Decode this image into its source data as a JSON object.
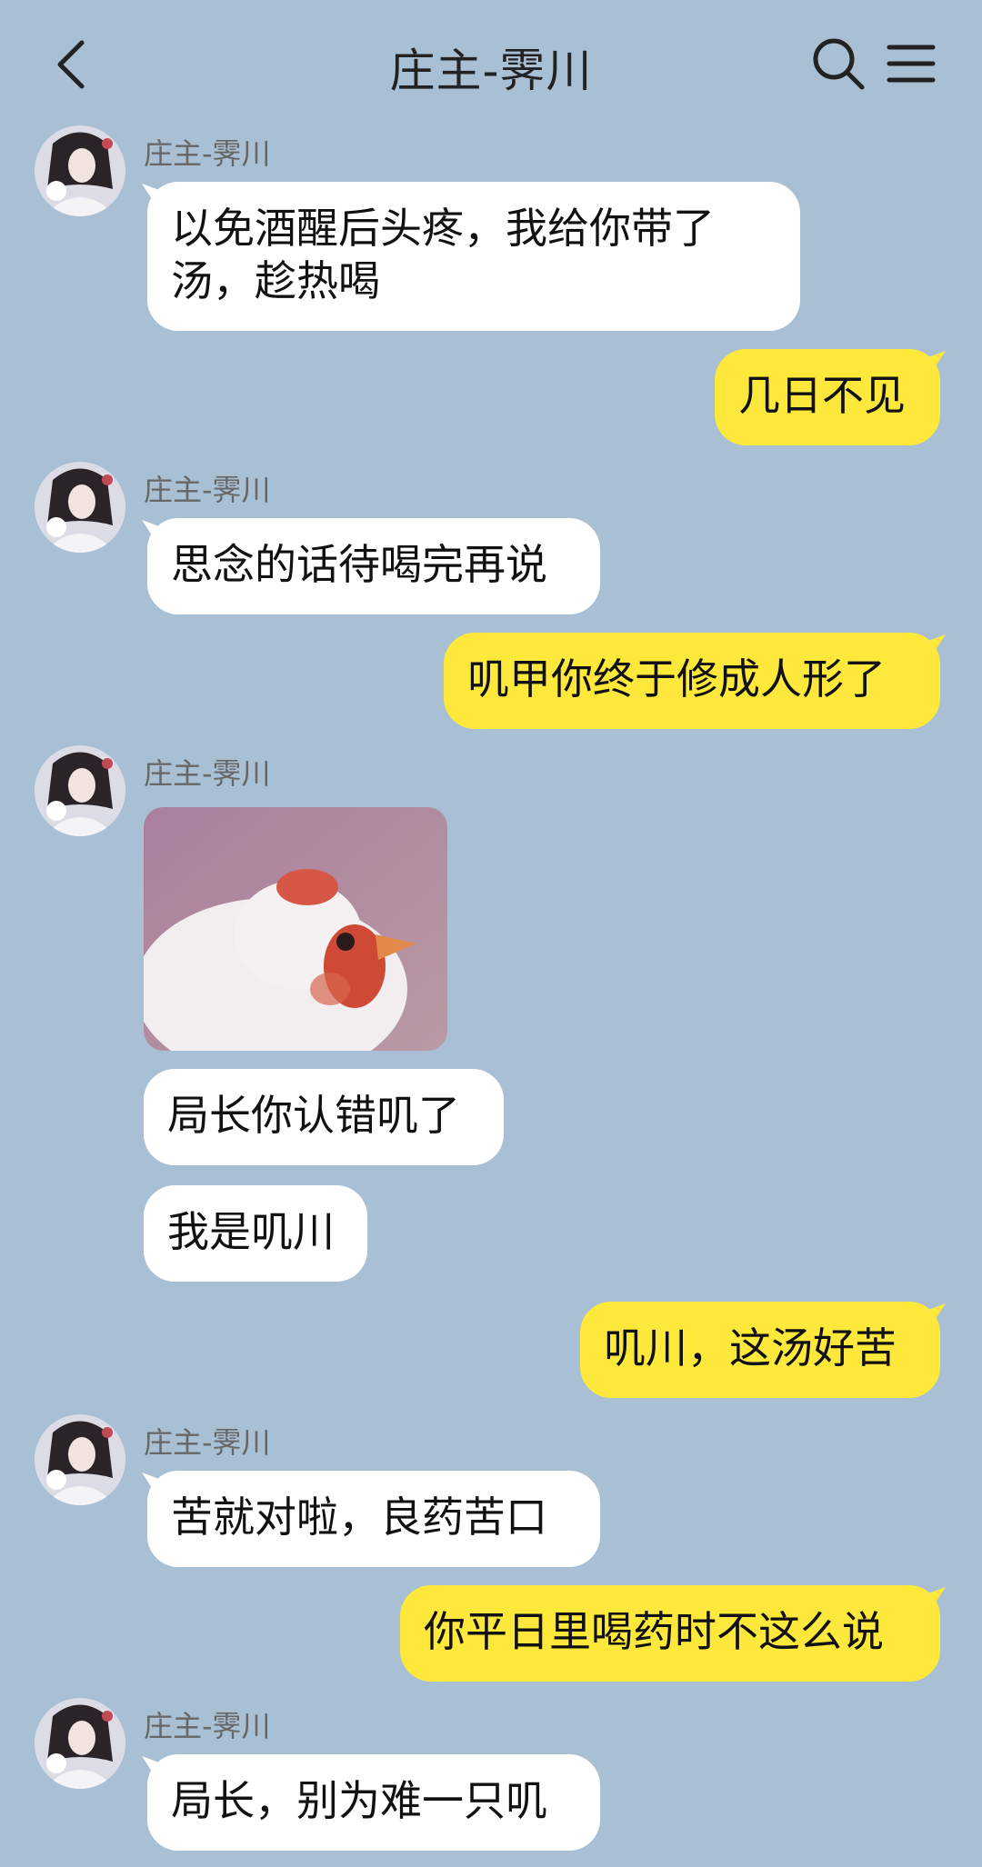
{
  "header": {
    "title": "庄主-霁川",
    "back_icon": "chevron-left-icon",
    "search_icon": "search-icon",
    "menu_icon": "hamburger-menu-icon"
  },
  "messages": [
    {
      "from": "other",
      "name": "庄主-霁川",
      "text": "以免酒醒后头疼，我给你带了汤，趁热喝"
    },
    {
      "from": "me",
      "text": "几日不见"
    },
    {
      "from": "other",
      "name": "庄主-霁川",
      "text": "思念的话待喝完再说"
    },
    {
      "from": "me",
      "text": "叽甲你终于修成人形了"
    },
    {
      "from": "other",
      "name": "庄主-霁川",
      "sticker": "chicken-sticker"
    },
    {
      "from": "other",
      "text": "局长你认错叽了"
    },
    {
      "from": "other",
      "text": "我是叽川"
    },
    {
      "from": "me",
      "text": "叽川，这汤好苦"
    },
    {
      "from": "other",
      "name": "庄主-霁川",
      "text": "苦就对啦，良药苦口"
    },
    {
      "from": "me",
      "text": "你平日里喝药时不这么说"
    },
    {
      "from": "other",
      "name": "庄主-霁川",
      "text": "局长，别为难一只叽"
    }
  ],
  "colors": {
    "background": "#a9bfd3",
    "my_bubble": "#fde83b",
    "their_bubble": "#ffffff"
  }
}
